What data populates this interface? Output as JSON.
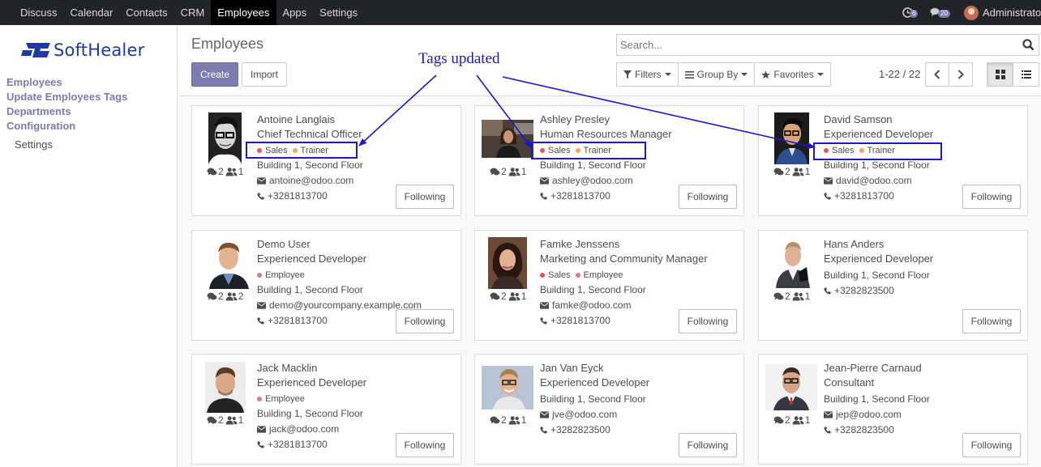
{
  "topbar": {
    "menu": [
      {
        "id": "discuss",
        "label": "Discuss"
      },
      {
        "id": "calendar",
        "label": "Calendar"
      },
      {
        "id": "contacts",
        "label": "Contacts"
      },
      {
        "id": "crm",
        "label": "CRM"
      },
      {
        "id": "employees",
        "label": "Employees",
        "active": true
      },
      {
        "id": "apps",
        "label": "Apps"
      },
      {
        "id": "settings",
        "label": "Settings"
      }
    ],
    "activity_count": "6",
    "message_count": "20",
    "user_name": "Administrator"
  },
  "sidebar": {
    "logo_text": "SoftHealer",
    "items": [
      {
        "label": "Employees"
      },
      {
        "label": "Update Employees Tags"
      },
      {
        "label": "Departments"
      },
      {
        "label": "Configuration"
      }
    ],
    "sub_item": "Settings"
  },
  "control_panel": {
    "title": "Employees",
    "create_label": "Create",
    "import_label": "Import",
    "search_placeholder": "Search...",
    "filters_label": "Filters",
    "groupby_label": "Group By",
    "favorites_label": "Favorites",
    "pager": "1-22 / 22"
  },
  "annotation": {
    "label": "Tags updated"
  },
  "tag_colors": {
    "Sales": "#e85454",
    "Trainer": "#f0a35a",
    "Employee": "#e8747c"
  },
  "employees": [
    {
      "name": "Antoine Langlais",
      "job": "Chief Technical Officer",
      "tags": [
        "Sales",
        "Trainer"
      ],
      "location": "Building 1, Second Floor",
      "email": "antoine@odoo.com",
      "phone": "+3281813700",
      "messages": "2",
      "followers": "1",
      "button": "Following"
    },
    {
      "name": "Ashley Presley",
      "job": "Human Resources Manager",
      "tags": [
        "Sales",
        "Trainer"
      ],
      "location": "Building 1, Second Floor",
      "email": "ashley@odoo.com",
      "phone": "+3281813700",
      "messages": "2",
      "followers": "1",
      "button": "Following"
    },
    {
      "name": "David Samson",
      "job": "Experienced Developer",
      "tags": [
        "Sales",
        "Trainer"
      ],
      "location": "Building 1, Second Floor",
      "email": "david@odoo.com",
      "phone": "+3281813700",
      "messages": "2",
      "followers": "1",
      "button": "Following"
    },
    {
      "name": "Demo User",
      "job": "Experienced Developer",
      "tags": [
        "Employee"
      ],
      "location": "Building 1, Second Floor",
      "email": "demo@yourcompany.example.com",
      "phone": "+3281813700",
      "messages": "2",
      "followers": "2",
      "button": "Following"
    },
    {
      "name": "Famke Jenssens",
      "job": "Marketing and Community Manager",
      "tags": [
        "Sales",
        "Employee"
      ],
      "location": "Building 1, Second Floor",
      "email": "famke@odoo.com",
      "phone": "+3281813700",
      "messages": "2",
      "followers": "1",
      "button": "Following"
    },
    {
      "name": "Hans Anders",
      "job": "Experienced Developer",
      "tags": [],
      "location": "Building 1, Second Floor",
      "email": "",
      "phone": "+3282823500",
      "messages": "2",
      "followers": "1",
      "button": "Following"
    },
    {
      "name": "Jack Macklin",
      "job": "Experienced Developer",
      "tags": [
        "Employee"
      ],
      "location": "Building 1, Second Floor",
      "email": "jack@odoo.com",
      "phone": "+3281813700",
      "messages": "2",
      "followers": "1",
      "button": "Following"
    },
    {
      "name": "Jan Van Eyck",
      "job": "Experienced Developer",
      "tags": [],
      "location": "Building 1, Second Floor",
      "email": "jve@odoo.com",
      "phone": "+3282823500",
      "messages": "2",
      "followers": "1",
      "button": "Following"
    },
    {
      "name": "Jean-Pierre Carnaud",
      "job": "Consultant",
      "tags": [],
      "location": "Building 1, Second Floor",
      "email": "jep@odoo.com",
      "phone": "+3282823500",
      "messages": "2",
      "followers": "1",
      "button": "Following"
    }
  ]
}
